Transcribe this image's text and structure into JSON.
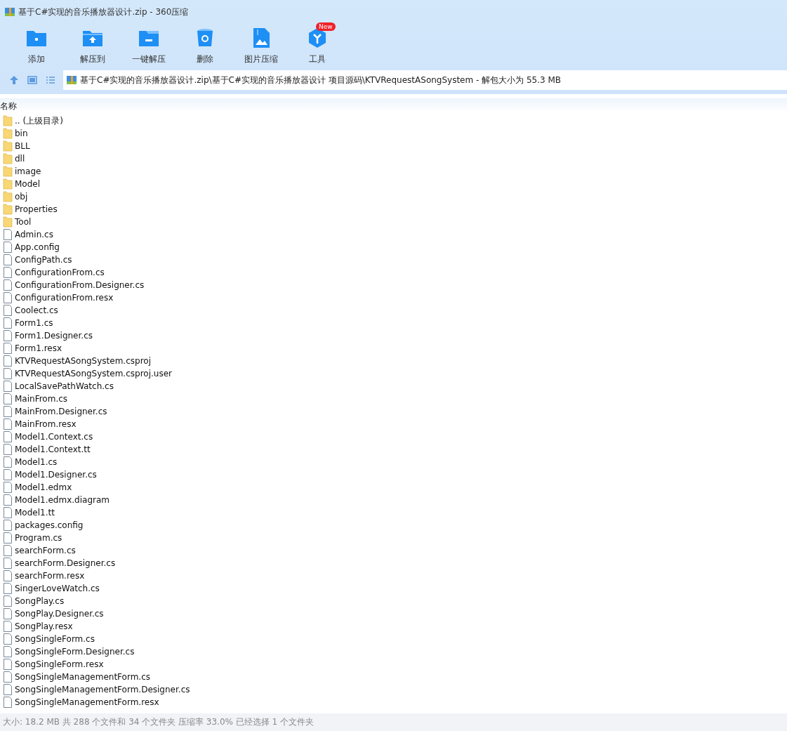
{
  "window": {
    "title": "基于C#实现的音乐播放器设计.zip - 360压缩"
  },
  "toolbar": [
    {
      "label": "添加",
      "kind": "add"
    },
    {
      "label": "解压到",
      "kind": "extract"
    },
    {
      "label": "一键解压",
      "kind": "oneclick"
    },
    {
      "label": "删除",
      "kind": "delete"
    },
    {
      "label": "图片压缩",
      "kind": "image"
    },
    {
      "label": "工具",
      "kind": "tools",
      "badge": "New"
    }
  ],
  "address": {
    "path": "基于C#实现的音乐播放器设计.zip\\基于C#实现的音乐播放器设计 项目源码\\KTVRequestASongSystem - 解包大小为 55.3 MB"
  },
  "table": {
    "columns": [
      "名称"
    ],
    "rows": [
      {
        "name": ".. (上级目录)",
        "kind": "folder"
      },
      {
        "name": "bin",
        "kind": "folder"
      },
      {
        "name": "BLL",
        "kind": "folder"
      },
      {
        "name": "dll",
        "kind": "folder"
      },
      {
        "name": "image",
        "kind": "folder"
      },
      {
        "name": "Model",
        "kind": "folder"
      },
      {
        "name": "obj",
        "kind": "folder"
      },
      {
        "name": "Properties",
        "kind": "folder"
      },
      {
        "name": "Tool",
        "kind": "folder"
      },
      {
        "name": "Admin.cs",
        "kind": "file"
      },
      {
        "name": "App.config",
        "kind": "file"
      },
      {
        "name": "ConfigPath.cs",
        "kind": "file"
      },
      {
        "name": "ConfigurationFrom.cs",
        "kind": "file"
      },
      {
        "name": "ConfigurationFrom.Designer.cs",
        "kind": "file"
      },
      {
        "name": "ConfigurationFrom.resx",
        "kind": "file"
      },
      {
        "name": "Coolect.cs",
        "kind": "file"
      },
      {
        "name": "Form1.cs",
        "kind": "file"
      },
      {
        "name": "Form1.Designer.cs",
        "kind": "file"
      },
      {
        "name": "Form1.resx",
        "kind": "file"
      },
      {
        "name": "KTVRequestASongSystem.csproj",
        "kind": "file"
      },
      {
        "name": "KTVRequestASongSystem.csproj.user",
        "kind": "file"
      },
      {
        "name": "LocalSavePathWatch.cs",
        "kind": "file"
      },
      {
        "name": "MainFrom.cs",
        "kind": "file"
      },
      {
        "name": "MainFrom.Designer.cs",
        "kind": "file"
      },
      {
        "name": "MainFrom.resx",
        "kind": "file"
      },
      {
        "name": "Model1.Context.cs",
        "kind": "file"
      },
      {
        "name": "Model1.Context.tt",
        "kind": "file"
      },
      {
        "name": "Model1.cs",
        "kind": "file"
      },
      {
        "name": "Model1.Designer.cs",
        "kind": "file"
      },
      {
        "name": "Model1.edmx",
        "kind": "file"
      },
      {
        "name": "Model1.edmx.diagram",
        "kind": "file"
      },
      {
        "name": "Model1.tt",
        "kind": "file"
      },
      {
        "name": "packages.config",
        "kind": "file"
      },
      {
        "name": "Program.cs",
        "kind": "file"
      },
      {
        "name": "searchForm.cs",
        "kind": "file"
      },
      {
        "name": "searchForm.Designer.cs",
        "kind": "file"
      },
      {
        "name": "searchForm.resx",
        "kind": "file"
      },
      {
        "name": "SingerLoveWatch.cs",
        "kind": "file"
      },
      {
        "name": "SongPlay.cs",
        "kind": "file"
      },
      {
        "name": "SongPlay.Designer.cs",
        "kind": "file"
      },
      {
        "name": "SongPlay.resx",
        "kind": "file"
      },
      {
        "name": "SongSingleForm.cs",
        "kind": "file"
      },
      {
        "name": "SongSingleForm.Designer.cs",
        "kind": "file"
      },
      {
        "name": "SongSingleForm.resx",
        "kind": "file"
      },
      {
        "name": "SongSingleManagementForm.cs",
        "kind": "file"
      },
      {
        "name": "SongSingleManagementForm.Designer.cs",
        "kind": "file"
      },
      {
        "name": "SongSingleManagementForm.resx",
        "kind": "file"
      }
    ]
  },
  "status_bar": {
    "text": "大小: 18.2 MB 共 288 个文件和 34 个文件夹 压缩率 33.0% 已经选择 1 个文件夹"
  }
}
